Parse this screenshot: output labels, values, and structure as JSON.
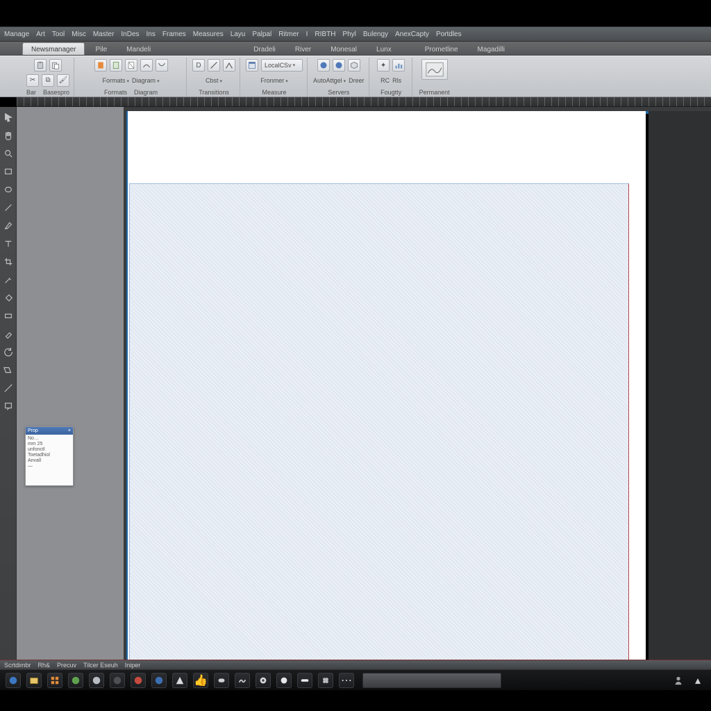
{
  "menubar": {
    "items": [
      "Manage",
      "Art",
      "Tool",
      "Misc",
      "Master",
      "InDes",
      "Ins",
      "Frames",
      "Measures",
      "Layu",
      "Palpal",
      "Ritmer",
      "I",
      "RIBTH",
      "Phyl",
      "Bulengy",
      "AnexCapty",
      "Portdles"
    ]
  },
  "tabstrip": {
    "tabs": [
      {
        "label": "Newsmanager",
        "active": true
      },
      {
        "label": "Pile",
        "active": false
      },
      {
        "label": "Mandeli",
        "active": false
      },
      {
        "label": "Dradeli",
        "active": false
      },
      {
        "label": "River",
        "active": false
      },
      {
        "label": "Monesal",
        "active": false
      },
      {
        "label": "Lunx",
        "active": false
      },
      {
        "label": "Prometline",
        "active": false
      },
      {
        "label": "Magadilli",
        "active": false
      }
    ]
  },
  "ribbon": {
    "groups": [
      {
        "rows": [
          [
            "clipboard-icon",
            "paste-icon"
          ],
          [
            "cut-icon",
            "copy-icon",
            "format-icon"
          ]
        ],
        "titles": [
          "Bar",
          "Basespro"
        ]
      },
      {
        "rows": [
          [
            "page-icon",
            "page-icon",
            "doc-icon",
            "connector-icon",
            "connector-icon"
          ],
          [
            "formats-drop",
            "diagram-drop"
          ]
        ],
        "titles": [
          "Formats",
          "Diagram"
        ]
      },
      {
        "rows": [
          [
            "d-icon",
            "line-icon",
            "angle-icon"
          ],
          [
            "cbst-label"
          ]
        ],
        "titles": [
          "Transitions"
        ]
      },
      {
        "rows": [
          [
            "panel-icon",
            "combo"
          ],
          [
            "fronmer-label"
          ]
        ],
        "titles": [
          "Measure"
        ]
      },
      {
        "rows": [
          [
            "globe-icon",
            "globe-icon",
            "cube-icon"
          ],
          [
            "auto-label",
            "delete-label"
          ]
        ],
        "titles": [
          "Servers"
        ]
      },
      {
        "rows": [
          [
            "wand-icon",
            "chart-icon"
          ],
          [
            "rc-label",
            "rls-label"
          ]
        ],
        "titles": [
          "Fougtty"
        ]
      },
      {
        "rows": [
          [
            "preview-stack"
          ]
        ],
        "titles": [
          "Permanent"
        ]
      }
    ],
    "labels": {
      "bar": "Bar",
      "basespro": "Basespro",
      "diagram": "Diagram",
      "formats": "Formats",
      "transitions": "Transitions",
      "cbst": "Cbst",
      "measure": "Measure",
      "fronmer": "Fronmer",
      "servers": "Servers",
      "autoattgel": "AutoAttgel",
      "dreer": "Dreer",
      "fougtty": "Fougtty",
      "rc": "RC",
      "rls": "Rls",
      "permanent": "Permanent",
      "localcsv": "LocalCSv"
    }
  },
  "floatPanel": {
    "title": "Prop",
    "rows": [
      "No…",
      "mm 25",
      "unfonctl",
      "Toetadhiol",
      "Anvall",
      "—"
    ]
  },
  "statusbar": {
    "items": [
      "Scrtdimbr",
      "Rh&",
      "Precuv",
      "Tilcer Eseuh",
      "Iniper"
    ]
  },
  "taskbar": {
    "buttons": [
      "start",
      "files",
      "hex",
      "orange",
      "green",
      "person",
      "swirl",
      "red-globe",
      "blue-globe",
      "up",
      "thumb",
      "yy",
      "wave",
      "record",
      "dot",
      "pill",
      "clover",
      "dots"
    ]
  }
}
